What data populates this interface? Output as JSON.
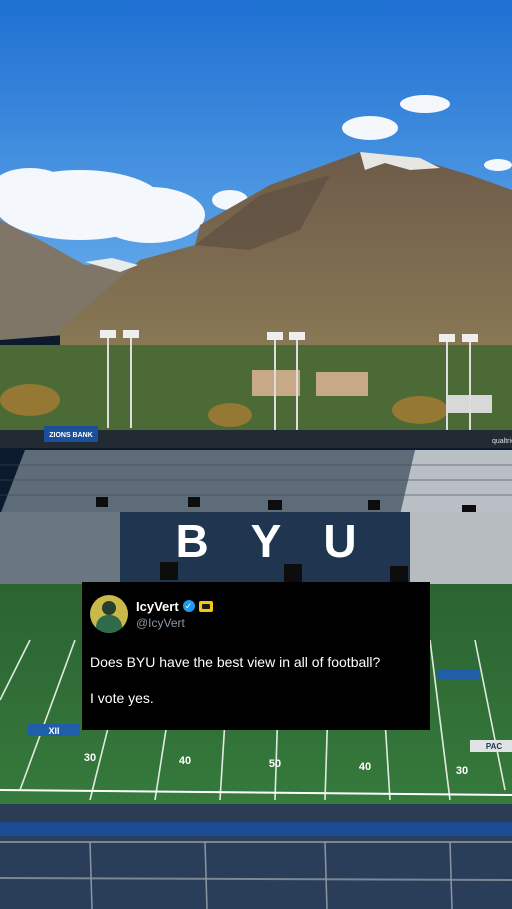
{
  "signage": {
    "sponsor_left": "ZIONS BANK",
    "sponsor_right": "qualtrics",
    "stands_letters": "BYU"
  },
  "field": {
    "yard_numbers": [
      "30",
      "40",
      "50",
      "40",
      "30"
    ],
    "conference_logo": "XII",
    "right_logo": "PAC"
  },
  "tweet": {
    "display_name": "IcyVert",
    "handle": "@IcyVert",
    "verified_icon": "verified-checkmark-icon",
    "badge_icon": "gold-badge-icon",
    "line1": "Does BYU have the best view in all of football?",
    "line2": "I vote yes."
  },
  "colors": {
    "sky": "#2f7fd6",
    "turf": "#2e6b34",
    "seats": "#1f3550",
    "card_bg": "#000000",
    "verified": "#1d9bf0"
  }
}
